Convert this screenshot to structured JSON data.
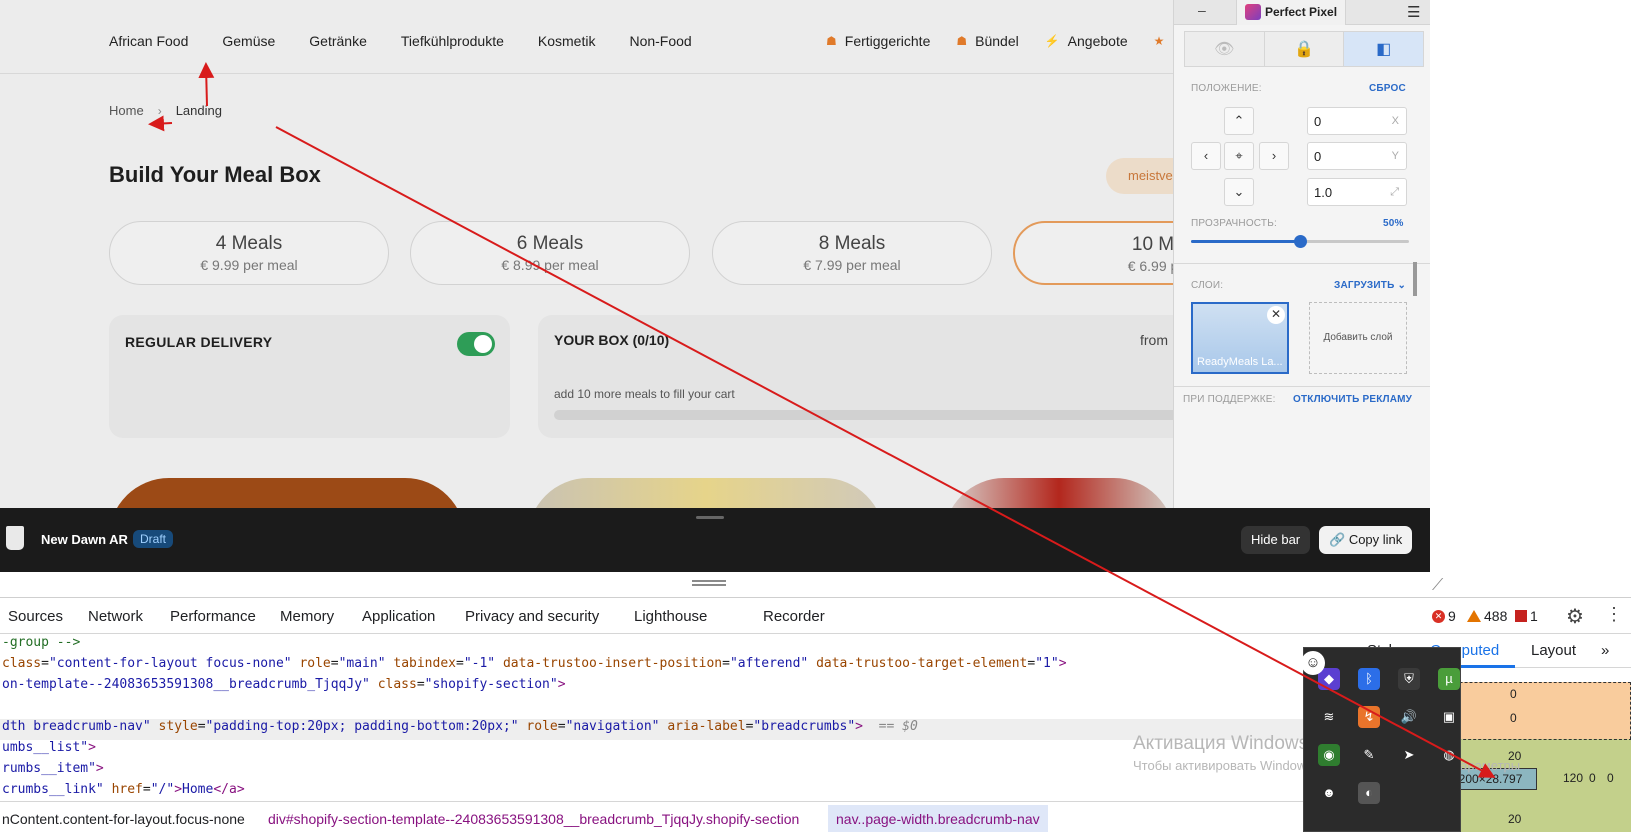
{
  "site": {
    "nav_left": [
      "African Food",
      "Gemüse",
      "Getränke",
      "Tiefkühlprodukte",
      "Kosmetik",
      "Non-Food"
    ],
    "nav_right": [
      {
        "icon": "chef-hat-icon",
        "label": "Fertiggerichte"
      },
      {
        "icon": "chef-hat-icon",
        "label": "Bündel"
      },
      {
        "icon": "lightning-icon",
        "label": "Angebote"
      },
      {
        "icon": "star-icon",
        "label": ""
      }
    ],
    "breadcrumb": {
      "home": "Home",
      "sep": "›",
      "current": "Landing"
    },
    "title": "Build Your Meal Box",
    "promo": "meistve",
    "meal_options": [
      {
        "title": "4 Meals",
        "price": "€ 9.99 per meal"
      },
      {
        "title": "6 Meals",
        "price": "€ 8.99 per meal"
      },
      {
        "title": "8 Meals",
        "price": "€ 7.99 per meal"
      },
      {
        "title": "10 M",
        "price": "€ 6.99 p"
      }
    ],
    "selected_meal_index": 3,
    "delivery": {
      "label": "REGULAR DELIVERY",
      "toggle_on": true
    },
    "box": {
      "title": "YOUR BOX (0/10)",
      "from": "from",
      "hint": "add 10 more meals to fill your cart",
      "progress": 0
    }
  },
  "perfect_pixel": {
    "minimize": "–",
    "name": "Perfect Pixel",
    "menu": "☰",
    "modes": [
      "eye-icon",
      "lock-icon",
      "invert-icon"
    ],
    "position_label": "ПОЛОЖЕНИЕ:",
    "reset_label": "СБРОС",
    "x_value": "0",
    "x_unit": "X",
    "y_value": "0",
    "y_unit": "Y",
    "scale_value": "1.0",
    "opacity_label": "ПРОЗРАЧНОСТЬ:",
    "opacity_value": "50%",
    "opacity": 0.5,
    "layers_label": "СЛОИ:",
    "load_label": "ЗАГРУЗИТЬ ⌄",
    "layer_name": "ReadyMeals La...",
    "add_layer": "Добавить слой",
    "support_label": "ПРИ ПОДДЕРЖКЕ:",
    "ads_label": "ОТКЛЮЧИТЬ РЕКЛАМУ"
  },
  "shopify_bar": {
    "store": "New Dawn AR",
    "badge": "Draft",
    "hide": "Hide bar",
    "copy": "Copy link"
  },
  "devtools": {
    "tabs": [
      "Sources",
      "Network",
      "Performance",
      "Memory",
      "Application",
      "Privacy and security",
      "Lighthouse",
      "Recorder"
    ],
    "errors": "9",
    "warnings": "488",
    "issues": "1",
    "code_lines": [
      {
        "t": "-group -->"
      },
      {
        "t": "class=\"content-for-layout focus-none\" role=\"main\" tabindex=\"-1\" data-trustoo-insert-position=\"afterend\" data-trustoo-target-element=\"1\">"
      },
      {
        "t": "on-template--24083653591308__breadcrumb_TjqqJy\" class=\"shopify-section\">"
      },
      {
        "t": ""
      },
      {
        "t": "dth breadcrumb-nav\" style=\"padding-top:20px; padding-bottom:20px;\" role=\"navigation\" aria-label=\"breadcrumbs\"> == $0"
      },
      {
        "t": "umbs__list\">"
      },
      {
        "t": "rumbs__item\">"
      },
      {
        "t": "crumbs__link\" href=\"/\">Home</a>"
      }
    ],
    "crumbs": [
      "nContent.content-for-layout.focus-none",
      "div#shopify-section-template--24083653591308__breadcrumb_TjqqJy.shopify-section",
      "nav..page-width.breadcrumb-nav"
    ],
    "side_tabs": [
      "Styles",
      "Computed",
      "Layout"
    ],
    "side_more": "»",
    "box_model": {
      "margin_top": "0",
      "border_top": "0",
      "padding_top": "0",
      "padding_top2": "20",
      "content": "1200×28.797",
      "right1": "120",
      "right2": "0",
      "right3": "0",
      "bottom": "20",
      "left_label": "g"
    },
    "watermark_title": "Активация Windows",
    "watermark_sub": "Чтобы активировать Windows, перейдите в раздел «Параметры"
  }
}
